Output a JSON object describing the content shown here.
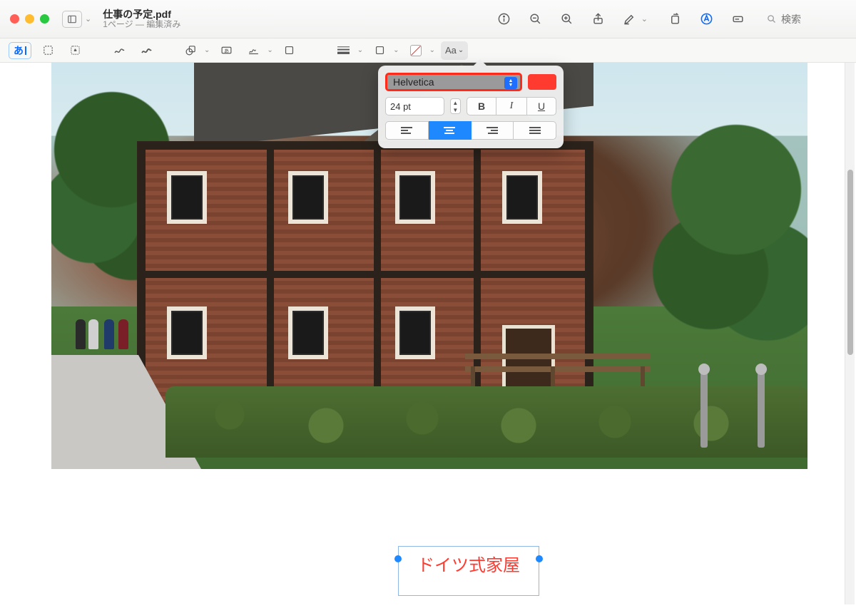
{
  "titlebar": {
    "filename": "仕事の予定.pdf",
    "subtitle": "1ページ — 編集済み",
    "search_placeholder": "検索"
  },
  "markup_toolbar": {
    "text_icon_label": "あ",
    "aa_label": "Aa"
  },
  "font_popover": {
    "font_name": "Helvetica",
    "size_label": "24 pt",
    "bold": "B",
    "italic": "I",
    "underline": "U",
    "text_color": "#ff3b30"
  },
  "annotation": {
    "text": "ドイツ式家屋"
  }
}
